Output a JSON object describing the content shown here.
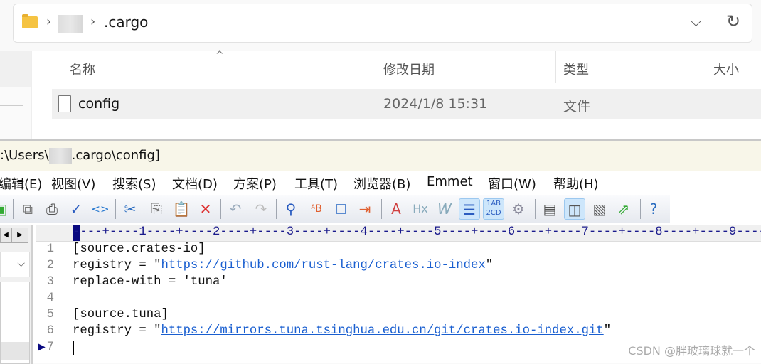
{
  "explorer": {
    "breadcrumb": {
      "current": ".cargo"
    },
    "columns": [
      "名称",
      "修改日期",
      "类型",
      "大小"
    ],
    "files": [
      {
        "name": "config",
        "modified": "2024/1/8 15:31",
        "type": "文件"
      }
    ]
  },
  "editor": {
    "title": ":\\Users\\",
    "title_suffix": ".cargo\\config]",
    "menu": [
      "编辑(E)",
      "视图(V)",
      "搜索(S)",
      "文档(D)",
      "方案(P)",
      "工具(T)",
      "浏览器(B)",
      "Emmet",
      "窗口(W)",
      "帮助(H)"
    ],
    "ruler": "----+----1----+----2----+----3----+----4----+----5----+----6----+----7----+----8----+----9----",
    "lines": [
      {
        "n": "1",
        "pre": "[source.crates-io]",
        "link": "",
        "post": ""
      },
      {
        "n": "2",
        "pre": "registry = \"",
        "link": "https://github.com/rust-lang/crates.io-index",
        "post": "\""
      },
      {
        "n": "3",
        "pre": "replace-with = 'tuna'",
        "link": "",
        "post": ""
      },
      {
        "n": "4",
        "pre": "",
        "link": "",
        "post": ""
      },
      {
        "n": "5",
        "pre": "[source.tuna]",
        "link": "",
        "post": ""
      },
      {
        "n": "6",
        "pre": "registry = \"",
        "link": "https://mirrors.tuna.tsinghua.edu.cn/git/crates.io-index.git",
        "post": "\""
      },
      {
        "n": "7",
        "pre": "",
        "link": "",
        "post": ""
      }
    ]
  },
  "watermark": "CSDN @胖玻璃球就一个"
}
